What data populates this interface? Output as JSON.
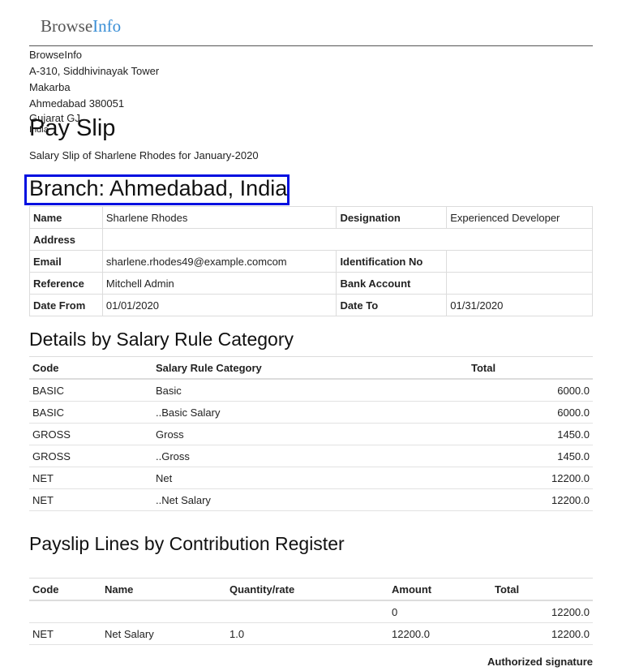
{
  "header": {
    "logo_main": "Browse",
    "logo_accent": "Info",
    "logo_accent_color": "#3a8fd6"
  },
  "company_address": [
    "BrowseInfo",
    "A-310, Siddhivinayak Tower",
    "Makarba",
    "Ahmedabad 380051",
    "Gujarat GJ",
    "India"
  ],
  "payslip": {
    "title": "Pay Slip",
    "subtitle": "Salary Slip of Sharlene Rhodes for January-2020",
    "branch": "Branch: Ahmedabad, India",
    "highlight_color": "#0010e0"
  },
  "employee": {
    "name_label": "Name",
    "name": "Sharlene Rhodes",
    "designation_label": "Designation",
    "designation": "Experienced Developer",
    "address_label": "Address",
    "address": "",
    "email_label": "Email",
    "email": "sharlene.rhodes49@example.comcom",
    "id_label": "Identification No",
    "id": "",
    "reference_label": "Reference",
    "reference": "Mitchell Admin",
    "bank_label": "Bank Account",
    "bank": "",
    "date_from_label": "Date From",
    "date_from": "01/01/2020",
    "date_to_label": "Date To",
    "date_to": "01/31/2020"
  },
  "category_section": {
    "title": "Details by Salary Rule Category",
    "headers": [
      "Code",
      "Salary Rule Category",
      "Total"
    ],
    "rows": [
      {
        "code": "BASIC",
        "category": "Basic",
        "total": "6000.0"
      },
      {
        "code": "BASIC",
        "category": "..Basic Salary",
        "total": "6000.0"
      },
      {
        "code": "GROSS",
        "category": "Gross",
        "total": "1450.0"
      },
      {
        "code": "GROSS",
        "category": "..Gross",
        "total": "1450.0"
      },
      {
        "code": "NET",
        "category": "Net",
        "total": "12200.0"
      },
      {
        "code": "NET",
        "category": "..Net Salary",
        "total": "12200.0"
      }
    ]
  },
  "contribution_section": {
    "title": "Payslip Lines by Contribution Register",
    "headers": [
      "Code",
      "Name",
      "Quantity/rate",
      "Amount",
      "Total"
    ],
    "rows": [
      {
        "code": "",
        "name": "",
        "qty": "",
        "amount": "0",
        "total": "12200.0"
      },
      {
        "code": "NET",
        "name": "Net Salary",
        "qty": "1.0",
        "amount": "12200.0",
        "total": "12200.0"
      }
    ]
  },
  "signature": "Authorized signature"
}
